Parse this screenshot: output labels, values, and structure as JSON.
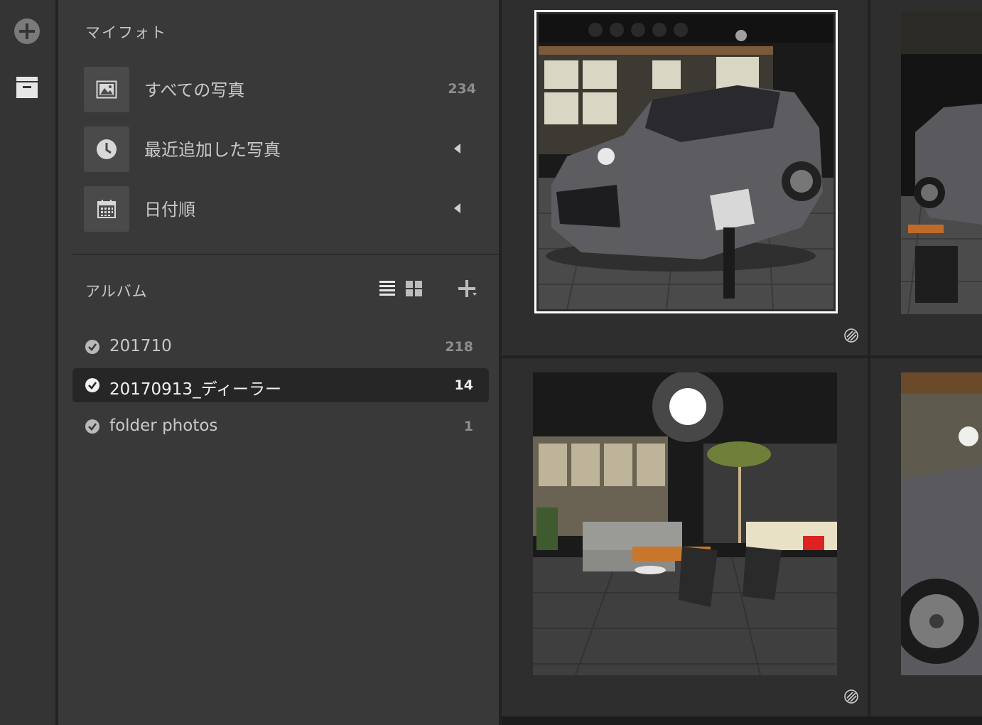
{
  "my_photos": {
    "title": "マイフォト",
    "items": [
      {
        "label": "すべての写真",
        "count": "234"
      },
      {
        "label": "最近追加した写真"
      },
      {
        "label": "日付順"
      }
    ]
  },
  "albums": {
    "title": "アルバム",
    "items": [
      {
        "name": "201710",
        "count": "218"
      },
      {
        "name": "20170913_ディーラー",
        "count": "14",
        "selected": true
      },
      {
        "name": "folder photos",
        "count": "1"
      }
    ]
  },
  "icons": {
    "rail": [
      "add-circle-icon",
      "archive-icon"
    ],
    "nav": [
      "image-icon",
      "clock-icon",
      "calendar-icon"
    ],
    "album_tools": [
      "list-view-icon",
      "grid-view-icon",
      "add-album-icon"
    ],
    "album": "check-circle-icon",
    "photo_badge": "stripes-badge-icon"
  },
  "colors": {
    "background": "#2b2b2b",
    "panel": "#393939",
    "selected_row": "#262626",
    "text": "#c9c9c9"
  }
}
